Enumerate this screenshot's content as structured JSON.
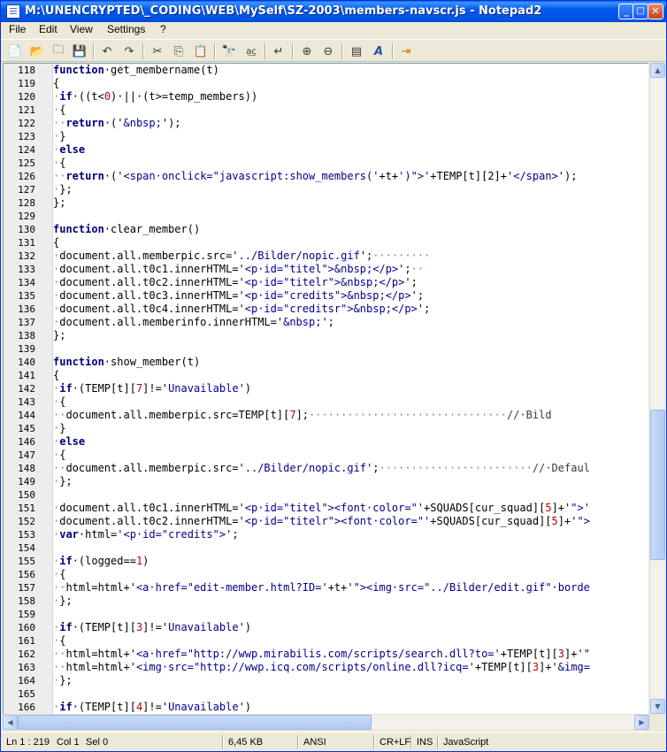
{
  "window": {
    "title": "M:\\UNENCRYPTED\\_CODING\\WEB\\MySelf\\SZ-2003\\members-navscr.js - Notepad2",
    "buttons": {
      "minimize": "_",
      "maximize": "□",
      "close": "✕"
    }
  },
  "menu": [
    {
      "label": "File"
    },
    {
      "label": "Edit"
    },
    {
      "label": "View"
    },
    {
      "label": "Settings"
    },
    {
      "label": "?"
    }
  ],
  "toolbar": [
    {
      "name": "new-icon",
      "glyph": "📄"
    },
    {
      "name": "open-icon",
      "glyph": "📂"
    },
    {
      "name": "browse-icon",
      "glyph": "🗀"
    },
    {
      "name": "save-icon",
      "glyph": "💾"
    },
    {
      "name": "undo-icon",
      "glyph": "↶"
    },
    {
      "name": "redo-icon",
      "glyph": "↷"
    },
    {
      "name": "cut-icon",
      "glyph": "✂"
    },
    {
      "name": "copy-icon",
      "glyph": "⎘"
    },
    {
      "name": "paste-icon",
      "glyph": "📋"
    },
    {
      "name": "find-icon",
      "glyph": "🔭"
    },
    {
      "name": "replace-icon",
      "glyph": "a͢c"
    },
    {
      "name": "wordwrap-icon",
      "glyph": "↵"
    },
    {
      "name": "zoom-in-icon",
      "glyph": "⊕"
    },
    {
      "name": "zoom-out-icon",
      "glyph": "⊖"
    },
    {
      "name": "scheme-icon",
      "glyph": "▤"
    },
    {
      "name": "font-icon",
      "glyph": "A"
    },
    {
      "name": "exit-icon",
      "glyph": "⇥"
    }
  ],
  "code_lines": [
    {
      "n": "118",
      "parts": [
        [
          "kw",
          "function"
        ],
        [
          "",
          "·get_membername(t)"
        ]
      ]
    },
    {
      "n": "119",
      "parts": [
        [
          "",
          "{"
        ]
      ]
    },
    {
      "n": "120",
      "parts": [
        [
          "ws",
          "·"
        ],
        [
          "kw",
          "if"
        ],
        [
          "",
          "·((t<"
        ],
        [
          "num",
          "0"
        ],
        [
          "",
          ")·||·(t>=temp_members))"
        ]
      ]
    },
    {
      "n": "121",
      "parts": [
        [
          "ws",
          "·"
        ],
        [
          "",
          "{"
        ]
      ]
    },
    {
      "n": "122",
      "parts": [
        [
          "ws",
          "··"
        ],
        [
          "kw",
          "return"
        ],
        [
          "",
          "·('"
        ],
        [
          "str",
          "&nbsp;"
        ],
        [
          "",
          "');"
        ]
      ]
    },
    {
      "n": "123",
      "parts": [
        [
          "ws",
          "·"
        ],
        [
          "",
          "}"
        ]
      ]
    },
    {
      "n": "124",
      "parts": [
        [
          "ws",
          "·"
        ],
        [
          "kw",
          "else"
        ]
      ]
    },
    {
      "n": "125",
      "parts": [
        [
          "ws",
          "·"
        ],
        [
          "",
          "{"
        ]
      ]
    },
    {
      "n": "126",
      "parts": [
        [
          "ws",
          "··"
        ],
        [
          "kw",
          "return"
        ],
        [
          "",
          "·('"
        ],
        [
          "str",
          "<span·onclick=\"javascript:show_members('"
        ],
        [
          "",
          "+t+"
        ],
        [
          "str",
          "')\">'"
        ],
        [
          "",
          "+TEMP[t][2]+'"
        ],
        [
          "str",
          "</span>"
        ],
        [
          "",
          "');"
        ]
      ]
    },
    {
      "n": "127",
      "parts": [
        [
          "ws",
          "·"
        ],
        [
          "",
          "};"
        ]
      ]
    },
    {
      "n": "128",
      "parts": [
        [
          "",
          "};"
        ]
      ]
    },
    {
      "n": "129",
      "parts": []
    },
    {
      "n": "130",
      "parts": [
        [
          "kw",
          "function"
        ],
        [
          "",
          "·clear_member()"
        ]
      ]
    },
    {
      "n": "131",
      "parts": [
        [
          "",
          "{"
        ]
      ]
    },
    {
      "n": "132",
      "parts": [
        [
          "ws",
          "·"
        ],
        [
          "",
          "document.all.memberpic.src='"
        ],
        [
          "str",
          "../Bilder/nopic.gif"
        ],
        [
          "",
          "';"
        ],
        [
          "ws",
          "·········"
        ]
      ]
    },
    {
      "n": "133",
      "parts": [
        [
          "ws",
          "·"
        ],
        [
          "",
          "document.all.t0c1.innerHTML='"
        ],
        [
          "str",
          "<p·id=\"titel\">&nbsp;</p>"
        ],
        [
          "",
          "';"
        ],
        [
          "ws",
          "··"
        ]
      ]
    },
    {
      "n": "134",
      "parts": [
        [
          "ws",
          "·"
        ],
        [
          "",
          "document.all.t0c2.innerHTML='"
        ],
        [
          "str",
          "<p·id=\"titelr\">&nbsp;</p>"
        ],
        [
          "",
          "';"
        ]
      ]
    },
    {
      "n": "135",
      "parts": [
        [
          "ws",
          "·"
        ],
        [
          "",
          "document.all.t0c3.innerHTML='"
        ],
        [
          "str",
          "<p·id=\"credits\">&nbsp;</p>"
        ],
        [
          "",
          "';"
        ]
      ]
    },
    {
      "n": "136",
      "parts": [
        [
          "ws",
          "·"
        ],
        [
          "",
          "document.all.t0c4.innerHTML='"
        ],
        [
          "str",
          "<p·id=\"creditsr\">&nbsp;</p>"
        ],
        [
          "",
          "';"
        ]
      ]
    },
    {
      "n": "137",
      "parts": [
        [
          "ws",
          "·"
        ],
        [
          "",
          "document.all.memberinfo.innerHTML='"
        ],
        [
          "str",
          "&nbsp;"
        ],
        [
          "",
          "';"
        ]
      ]
    },
    {
      "n": "138",
      "parts": [
        [
          "",
          "};"
        ]
      ]
    },
    {
      "n": "139",
      "parts": []
    },
    {
      "n": "140",
      "parts": [
        [
          "kw",
          "function"
        ],
        [
          "",
          "·show_member(t)"
        ]
      ]
    },
    {
      "n": "141",
      "parts": [
        [
          "",
          "{"
        ]
      ]
    },
    {
      "n": "142",
      "parts": [
        [
          "ws",
          "·"
        ],
        [
          "kw",
          "if"
        ],
        [
          "",
          "·(TEMP[t]["
        ],
        [
          "num",
          "7"
        ],
        [
          "",
          "]!='"
        ],
        [
          "str",
          "Unavailable"
        ],
        [
          "",
          "')"
        ]
      ]
    },
    {
      "n": "143",
      "parts": [
        [
          "ws",
          "·"
        ],
        [
          "",
          "{"
        ]
      ]
    },
    {
      "n": "144",
      "parts": [
        [
          "ws",
          "··"
        ],
        [
          "",
          "document.all.memberpic.src=TEMP[t]["
        ],
        [
          "num",
          "7"
        ],
        [
          "",
          "];"
        ],
        [
          "ws",
          "·······························"
        ],
        [
          "cm",
          "//·Bild"
        ]
      ]
    },
    {
      "n": "145",
      "parts": [
        [
          "ws",
          "·"
        ],
        [
          "",
          "}"
        ]
      ]
    },
    {
      "n": "146",
      "parts": [
        [
          "ws",
          "·"
        ],
        [
          "kw",
          "else"
        ]
      ]
    },
    {
      "n": "147",
      "parts": [
        [
          "ws",
          "·"
        ],
        [
          "",
          "{"
        ]
      ]
    },
    {
      "n": "148",
      "parts": [
        [
          "ws",
          "··"
        ],
        [
          "",
          "document.all.memberpic.src='"
        ],
        [
          "str",
          "../Bilder/nopic.gif"
        ],
        [
          "",
          "';"
        ],
        [
          "ws",
          "························"
        ],
        [
          "cm",
          "//·Defaul"
        ]
      ]
    },
    {
      "n": "149",
      "parts": [
        [
          "ws",
          "·"
        ],
        [
          "",
          "};"
        ]
      ]
    },
    {
      "n": "150",
      "parts": []
    },
    {
      "n": "151",
      "parts": [
        [
          "ws",
          "·"
        ],
        [
          "",
          "document.all.t0c1.innerHTML='"
        ],
        [
          "str",
          "<p·id=\"titel\"><font·color=\"'"
        ],
        [
          "",
          "+SQUADS[cur_squad]["
        ],
        [
          "num",
          "5"
        ],
        [
          "",
          "]+'"
        ],
        [
          "str",
          "\">'"
        ]
      ]
    },
    {
      "n": "152",
      "parts": [
        [
          "ws",
          "·"
        ],
        [
          "",
          "document.all.t0c2.innerHTML='"
        ],
        [
          "str",
          "<p·id=\"titelr\"><font·color=\"'"
        ],
        [
          "",
          "+SQUADS[cur_squad]["
        ],
        [
          "num",
          "5"
        ],
        [
          "",
          "]+'"
        ],
        [
          "str",
          "\">"
        ]
      ]
    },
    {
      "n": "153",
      "parts": [
        [
          "ws",
          "·"
        ],
        [
          "kw",
          "var"
        ],
        [
          "",
          "·html='"
        ],
        [
          "str",
          "<p·id=\"credits\">"
        ],
        [
          "",
          "';"
        ]
      ]
    },
    {
      "n": "154",
      "parts": []
    },
    {
      "n": "155",
      "parts": [
        [
          "ws",
          "·"
        ],
        [
          "kw",
          "if"
        ],
        [
          "",
          "·(logged=="
        ],
        [
          "num",
          "1"
        ],
        [
          "",
          ")"
        ]
      ]
    },
    {
      "n": "156",
      "parts": [
        [
          "ws",
          "·"
        ],
        [
          "",
          "{"
        ]
      ]
    },
    {
      "n": "157",
      "parts": [
        [
          "ws",
          "··"
        ],
        [
          "",
          "html=html+'"
        ],
        [
          "str",
          "<a·href=\"edit-member.html?ID='"
        ],
        [
          "",
          "+t+'"
        ],
        [
          "str",
          "\"><img·src=\"../Bilder/edit.gif\"·borde"
        ]
      ]
    },
    {
      "n": "158",
      "parts": [
        [
          "ws",
          "·"
        ],
        [
          "",
          "};"
        ]
      ]
    },
    {
      "n": "159",
      "parts": []
    },
    {
      "n": "160",
      "parts": [
        [
          "ws",
          "·"
        ],
        [
          "kw",
          "if"
        ],
        [
          "",
          "·(TEMP[t]["
        ],
        [
          "num",
          "3"
        ],
        [
          "",
          "]!='"
        ],
        [
          "str",
          "Unavailable"
        ],
        [
          "",
          "')"
        ]
      ]
    },
    {
      "n": "161",
      "parts": [
        [
          "ws",
          "·"
        ],
        [
          "",
          "{"
        ]
      ]
    },
    {
      "n": "162",
      "parts": [
        [
          "ws",
          "··"
        ],
        [
          "",
          "html=html+'"
        ],
        [
          "str",
          "<a·href=\"http://wwp.mirabilis.com/scripts/search.dll?to='"
        ],
        [
          "",
          "+TEMP[t]["
        ],
        [
          "num",
          "3"
        ],
        [
          "",
          "]+'"
        ],
        [
          "str",
          "\""
        ]
      ]
    },
    {
      "n": "163",
      "parts": [
        [
          "ws",
          "··"
        ],
        [
          "",
          "html=html+'"
        ],
        [
          "str",
          "<img·src=\"http://wwp.icq.com/scripts/online.dll?icq='"
        ],
        [
          "",
          "+TEMP[t]["
        ],
        [
          "num",
          "3"
        ],
        [
          "",
          "]+'"
        ],
        [
          "str",
          "&img="
        ]
      ]
    },
    {
      "n": "164",
      "parts": [
        [
          "ws",
          "·"
        ],
        [
          "",
          "};"
        ]
      ]
    },
    {
      "n": "165",
      "parts": []
    },
    {
      "n": "166",
      "parts": [
        [
          "ws",
          "·"
        ],
        [
          "kw",
          "if"
        ],
        [
          "",
          "·(TEMP[t]["
        ],
        [
          "num",
          "4"
        ],
        [
          "",
          "]!='"
        ],
        [
          "str",
          "Unavailable"
        ],
        [
          "",
          "')"
        ]
      ]
    }
  ],
  "status": {
    "position": "Ln 1 : 219",
    "col": "Col 1",
    "sel": "Sel 0",
    "size": "6,45 KB",
    "encoding": "ANSI",
    "eol": "CR+LF",
    "mode": "INS",
    "lexer": "JavaScript"
  },
  "colors": {
    "titlebar": "#0054E3",
    "keyword": "#00007A",
    "string": "#00008B",
    "number": "#C00000",
    "whitespace": "#C86464"
  }
}
